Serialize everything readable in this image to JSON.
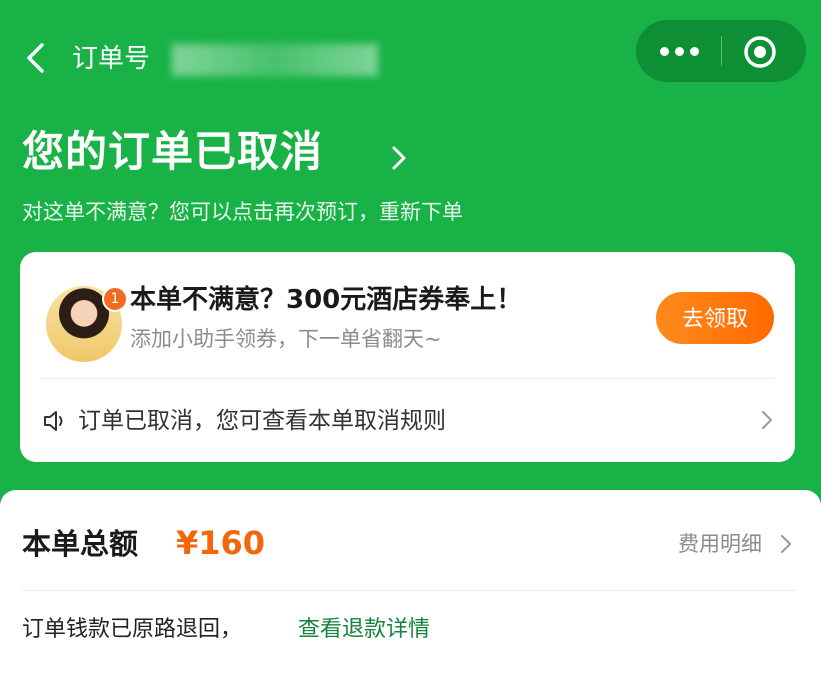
{
  "nav": {
    "order_label": "订单号",
    "order_number": "",
    "icons": [
      "back-icon",
      "more-icon",
      "target-icon"
    ]
  },
  "status": {
    "title": "您的订单已取消",
    "subtitle": "对这单不满意？您可以点击再次预订，重新下单"
  },
  "promo": {
    "badge": "1",
    "title": "本单不满意？300元酒店券奉上！",
    "subtitle": "添加小助手领券，下一单省翻天~",
    "button_label": "去领取"
  },
  "cancel_notice": {
    "text": "订单已取消，您可查看本单取消规则"
  },
  "fee": {
    "total_label": "本单总额",
    "total_amount": "¥160",
    "detail_label": "费用明细",
    "refund_text": "订单钱款已原路退回，",
    "refund_link": "查看退款详情"
  },
  "colors": {
    "brand_green": "#19b247",
    "capsule_green": "#0e8f35",
    "accent_orange": "#f5650b",
    "button_orange": "#ff6a00",
    "link_green": "#17823b"
  }
}
